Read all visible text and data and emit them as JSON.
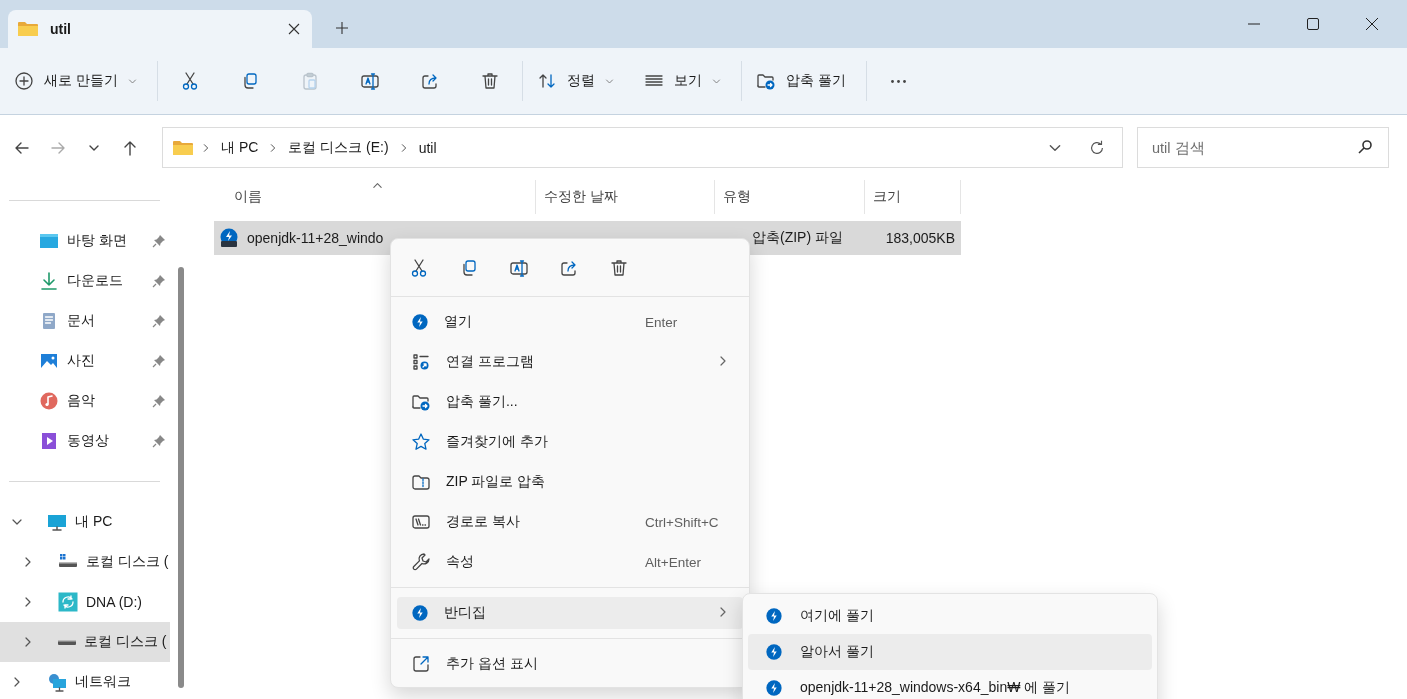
{
  "window": {
    "tabs": [
      {
        "title": "util",
        "selected": true
      }
    ]
  },
  "toolbar": {
    "groups": [
      [
        {
          "kind": "new",
          "label": "새로 만들기",
          "dropdown": true,
          "disabled": false
        }
      ],
      [
        {
          "kind": "cut",
          "disabled": false
        },
        {
          "kind": "copy",
          "disabled": false
        },
        {
          "kind": "paste",
          "disabled": true
        },
        {
          "kind": "rename",
          "disabled": false
        },
        {
          "kind": "share",
          "disabled": false
        },
        {
          "kind": "delete",
          "disabled": false
        }
      ],
      [
        {
          "kind": "sort",
          "label": "정렬",
          "dropdown": true,
          "disabled": false
        },
        {
          "kind": "view",
          "label": "보기",
          "dropdown": true,
          "disabled": false
        }
      ],
      [
        {
          "kind": "extract",
          "label": "압축 풀기",
          "dropdown": false,
          "disabled": false
        }
      ],
      [
        {
          "kind": "more",
          "disabled": false
        }
      ]
    ]
  },
  "navigation": [
    {
      "kind": "back",
      "disabled": false
    },
    {
      "kind": "forward",
      "disabled": true
    },
    {
      "kind": "recent",
      "disabled": false
    },
    {
      "kind": "up",
      "disabled": false
    }
  ],
  "address_bar": {
    "path": [
      "내 PC",
      "로컬 디스크 (E:)",
      "util"
    ]
  },
  "search": {
    "placeholder": "util 검색"
  },
  "sidebar": {
    "quick_access": [
      {
        "kind": "desktop",
        "label": "바탕 화면",
        "pinned": true
      },
      {
        "kind": "download",
        "label": "다운로드",
        "pinned": true
      },
      {
        "kind": "document",
        "label": "문서",
        "pinned": true
      },
      {
        "kind": "photo",
        "label": "사진",
        "pinned": true
      },
      {
        "kind": "music",
        "label": "음악",
        "pinned": true
      },
      {
        "kind": "video",
        "label": "동영상",
        "pinned": true
      }
    ],
    "tree": [
      {
        "kind": "pc",
        "label": "내 PC",
        "expanded": true,
        "selected": false,
        "children": [
          {
            "kind": "system-drive",
            "label": "로컬 디스크 (",
            "expanded": false,
            "selected": false
          },
          {
            "kind": "sync-drive",
            "label": "DNA (D:)",
            "expanded": false,
            "selected": false
          },
          {
            "kind": "drive",
            "label": "로컬 디스크 (",
            "expanded": false,
            "selected": true
          }
        ]
      },
      {
        "kind": "network",
        "label": "네트워크",
        "expanded": false,
        "selected": false
      }
    ]
  },
  "file_list": {
    "columns": [
      {
        "label": "이름",
        "sorted": true
      },
      {
        "label": "수정한 날짜",
        "sorted": false
      },
      {
        "label": "유형",
        "sorted": false
      },
      {
        "label": "크기",
        "sorted": false
      }
    ],
    "rows": [
      {
        "name": "openjdk-11+28_windo",
        "type": "압축(ZIP) 파일",
        "size": "183,005KB",
        "selected": true
      }
    ]
  },
  "context_menu": {
    "actions": [
      {
        "kind": "cut"
      },
      {
        "kind": "copy"
      },
      {
        "kind": "rename"
      },
      {
        "kind": "share"
      },
      {
        "kind": "delete"
      }
    ],
    "groups": [
      [
        {
          "kind": "bandizip",
          "label": "열기",
          "shortcut": "Enter",
          "submenu": false,
          "selected": false
        },
        {
          "kind": "open-with",
          "label": "연결 프로그램",
          "submenu": true,
          "selected": false
        },
        {
          "kind": "extract",
          "label": "압축 풀기...",
          "submenu": false,
          "selected": false
        },
        {
          "kind": "star",
          "label": "즐겨찾기에 추가",
          "submenu": false,
          "selected": false
        },
        {
          "kind": "zip",
          "label": "ZIP 파일로 압축",
          "submenu": false,
          "selected": false
        },
        {
          "kind": "path",
          "label": "경로로 복사",
          "shortcut": "Ctrl+Shift+C",
          "submenu": false,
          "selected": false
        },
        {
          "kind": "wrench",
          "label": "속성",
          "shortcut": "Alt+Enter",
          "submenu": false,
          "selected": false
        }
      ],
      [
        {
          "kind": "bandizip",
          "label": "반디집",
          "submenu": true,
          "selected": true
        }
      ],
      [
        {
          "kind": "more-options",
          "label": "추가 옵션 표시",
          "submenu": false,
          "selected": false
        }
      ]
    ]
  },
  "submenu": {
    "items": [
      {
        "label": "여기에 풀기",
        "selected": false
      },
      {
        "label": "알아서 풀기",
        "selected": true
      },
      {
        "label": "openjdk-11+28_windows-x64_bin₩ 에 풀기",
        "selected": false
      }
    ]
  }
}
